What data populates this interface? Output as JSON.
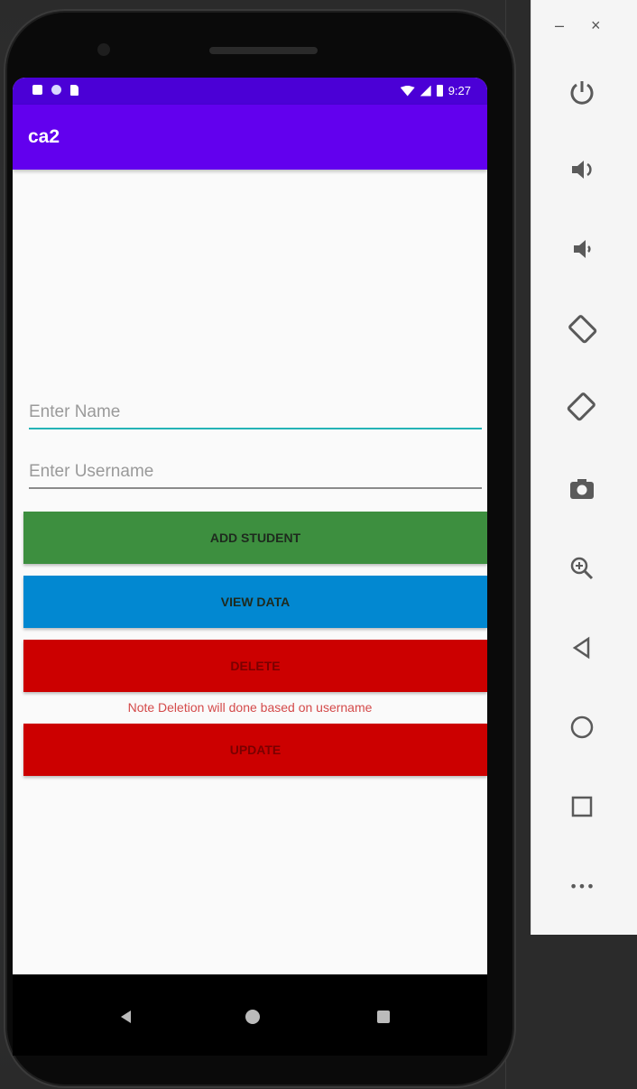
{
  "status_bar": {
    "time": "9:27"
  },
  "app_bar": {
    "title": "ca2"
  },
  "form": {
    "name_placeholder": "Enter Name",
    "username_placeholder": "Enter Username"
  },
  "buttons": {
    "add_student": "ADD STUDENT",
    "view_data": "VIEW DATA",
    "delete": "DELETE",
    "update": "UPDATE"
  },
  "note": "Note Deletion will done based on username",
  "emulator_panel": {
    "minimize_label": "–",
    "close_label": "×",
    "more_label": "•••",
    "tools": [
      "power-icon",
      "volume-up-icon",
      "volume-down-icon",
      "rotate-left-icon",
      "rotate-right-icon",
      "camera-icon",
      "zoom-icon",
      "back-icon",
      "home-icon",
      "overview-icon",
      "more-icon"
    ]
  },
  "colors": {
    "app_bar": "#6200ee",
    "status_bar": "#4b00d6",
    "add_button": "#3d8f3f",
    "view_button": "#0288d1",
    "delete_button": "#cc0000",
    "update_button": "#cc0000",
    "note_text": "#d44a4a"
  }
}
